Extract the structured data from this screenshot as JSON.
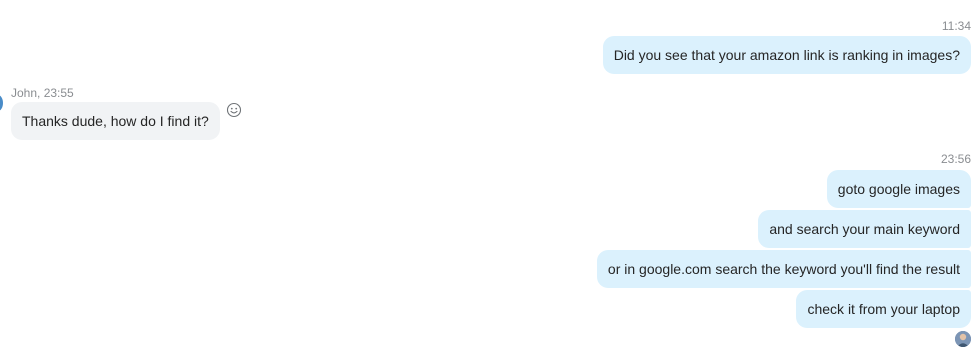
{
  "messages": {
    "group1": {
      "timestamp": "11:34",
      "text": "Did you see that your amazon link is ranking in images?"
    },
    "group2": {
      "sender_time": "John, 23:55",
      "text": "Thanks dude, how do I find it?"
    },
    "group3": {
      "timestamp": "23:56",
      "texts": [
        "goto google images",
        "and search your main keyword",
        "or in google.com search the keyword you'll find the result",
        "check it from your laptop"
      ]
    }
  },
  "icons": {
    "reaction": "smiley-face-icon",
    "contact_avatar": "avatar",
    "self_avatar": "avatar"
  },
  "colors": {
    "outgoing_bubble": "#dbf1fd",
    "incoming_bubble": "#f1f3f5",
    "timestamp_text": "#8a8d91",
    "message_text": "#252525"
  }
}
